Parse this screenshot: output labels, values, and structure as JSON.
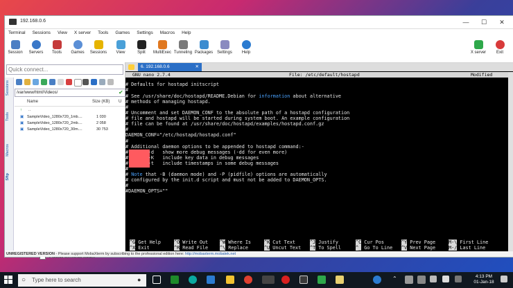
{
  "window": {
    "title": "192.168.0.6"
  },
  "menu": [
    "Terminal",
    "Sessions",
    "View",
    "X server",
    "Tools",
    "Games",
    "Settings",
    "Macros",
    "Help"
  ],
  "toolbar": [
    "Session",
    "Servers",
    "Tools",
    "Games",
    "Sessions",
    "View",
    "Split",
    "MultiExec",
    "Tunneling",
    "Packages",
    "Settings",
    "Help"
  ],
  "toolbar_right": [
    "X server",
    "Exit"
  ],
  "sidebar": {
    "quick_connect_placeholder": "Quick connect...",
    "vtabs": [
      "Sessions",
      "Tools",
      "Macros",
      "Sftp"
    ],
    "path": "/var/www/html/Videos/",
    "columns": {
      "name": "Name",
      "size": "Size (KB)"
    },
    "rows": [
      {
        "name": "..",
        "size": ""
      },
      {
        "name": "SampleVideo_1280x720_1mb....",
        "size": "1 030"
      },
      {
        "name": "SampleVideo_1280x720_2mb....",
        "size": "2 058"
      },
      {
        "name": "SampleVideo_1280x720_30m....",
        "size": "30 753"
      }
    ],
    "follow_label": "Follow terminal folder"
  },
  "terminal": {
    "tab_title": "6. 192.168.0.6",
    "nano_version": "GNU nano 2.7.4",
    "file": "File: /etc/default/hostapd",
    "status": "Modified",
    "lines": [
      "# Defaults for hostapd initscript",
      "#",
      "# See /usr/share/doc/hostapd/README.Debian for information about alternative",
      "# methods of managing hostapd.",
      "#",
      "# Uncomment and set DAEMON_CONF to the absolute path of a hostapd configuration",
      "# file and hostapd will be started during system boot. An example configuration",
      "# file can be found at /usr/share/doc/hostapd/examples/hostapd.conf.gz",
      "#",
      "DAEMON_CONF=\"/etc/hostapd/hostapd.conf\"",
      "#",
      "# Additional daemon options to be appended to hostapd command:-",
      "#       -d   show more debug messages (-dd for even more)",
      "#       -K   include key data in debug messages",
      "#       -t   include timestamps in some debug messages",
      "#",
      "# Note that -B (daemon mode) and -P (pidfile) options are automatically",
      "# configured by the init.d script and must not be added to DAEMON_OPTS.",
      "#",
      "#DAEMON_OPTS=\"\""
    ],
    "shortcuts": [
      [
        "^G",
        "Get Help",
        "^X",
        "Exit"
      ],
      [
        "^O",
        "Write Out",
        "^R",
        "Read File"
      ],
      [
        "^W",
        "Where Is",
        "^\\",
        "Replace"
      ],
      [
        "^K",
        "Cut Text",
        "^U",
        "Uncut Text"
      ],
      [
        "^J",
        "Justify",
        "^T",
        "To Spell"
      ],
      [
        "^C",
        "Cur Pos",
        "^_",
        "Go To Line"
      ],
      [
        "^Y",
        "Prev Page",
        "^V",
        "Next Page"
      ],
      [
        "M-\\",
        "First Line",
        "M-/",
        "Last Line"
      ]
    ]
  },
  "statusbar": {
    "label": "UNREGISTERED VERSION",
    "text": " - Please support MobaXterm by subscribing to the professional edition here: ",
    "link": "http://mobaxterm.mobatek.net"
  },
  "taskbar": {
    "search_placeholder": "Type here to search",
    "time": "4:13 PM",
    "date": "01-Jan-18"
  },
  "colors": {
    "accent": "#2b6fc6",
    "terminal_bg": "#000000",
    "note_blue": "#4aa3ff"
  }
}
